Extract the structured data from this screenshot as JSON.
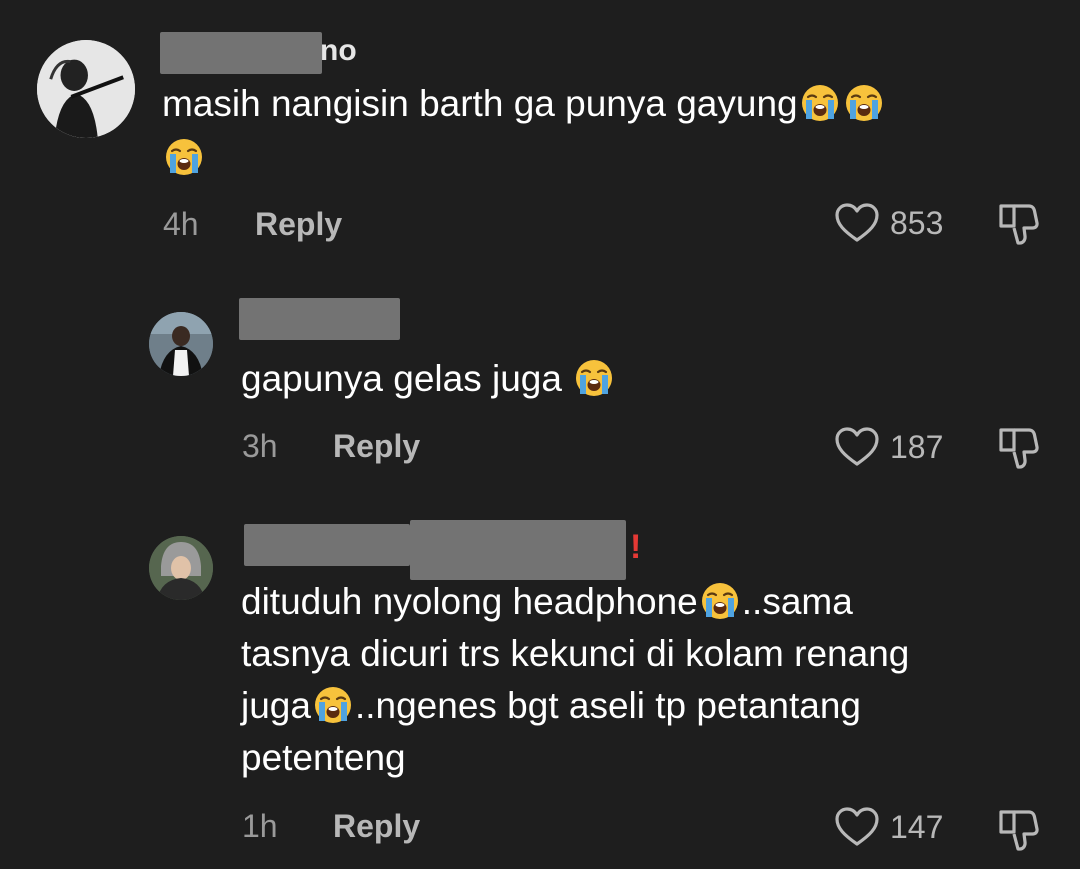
{
  "comments": [
    {
      "username_visible_suffix": "no",
      "text_line1": "masih nangisin barth ga punya gayung",
      "text_line2": "",
      "time": "4h",
      "reply_label": "Reply",
      "likes": "853",
      "emoji": "loudly-crying-face"
    },
    {
      "text_line1": "gapunya gelas juga",
      "time": "3h",
      "reply_label": "Reply",
      "likes": "187",
      "emoji": "loudly-crying-face"
    },
    {
      "username_badge": "!",
      "text_line1_a": "dituduh nyolong headphone",
      "text_line1_b": "..sama",
      "text_line2": "tasnya dicuri trs kekunci di kolam renang",
      "text_line3_a": "juga",
      "text_line3_b": "..ngenes bgt aseli tp petantang",
      "text_line4": "petenteng",
      "time": "1h",
      "reply_label": "Reply",
      "likes": "147",
      "emoji": "loudly-crying-face"
    }
  ],
  "icons": {
    "like": "heart-outline-icon",
    "dislike": "thumbs-down-outline-icon"
  },
  "colors": {
    "background": "#1e1e1e",
    "primary_text": "#ffffff",
    "secondary_text": "#9a9a9a",
    "action_text": "#b8b8b8",
    "badge": "#e53935"
  }
}
